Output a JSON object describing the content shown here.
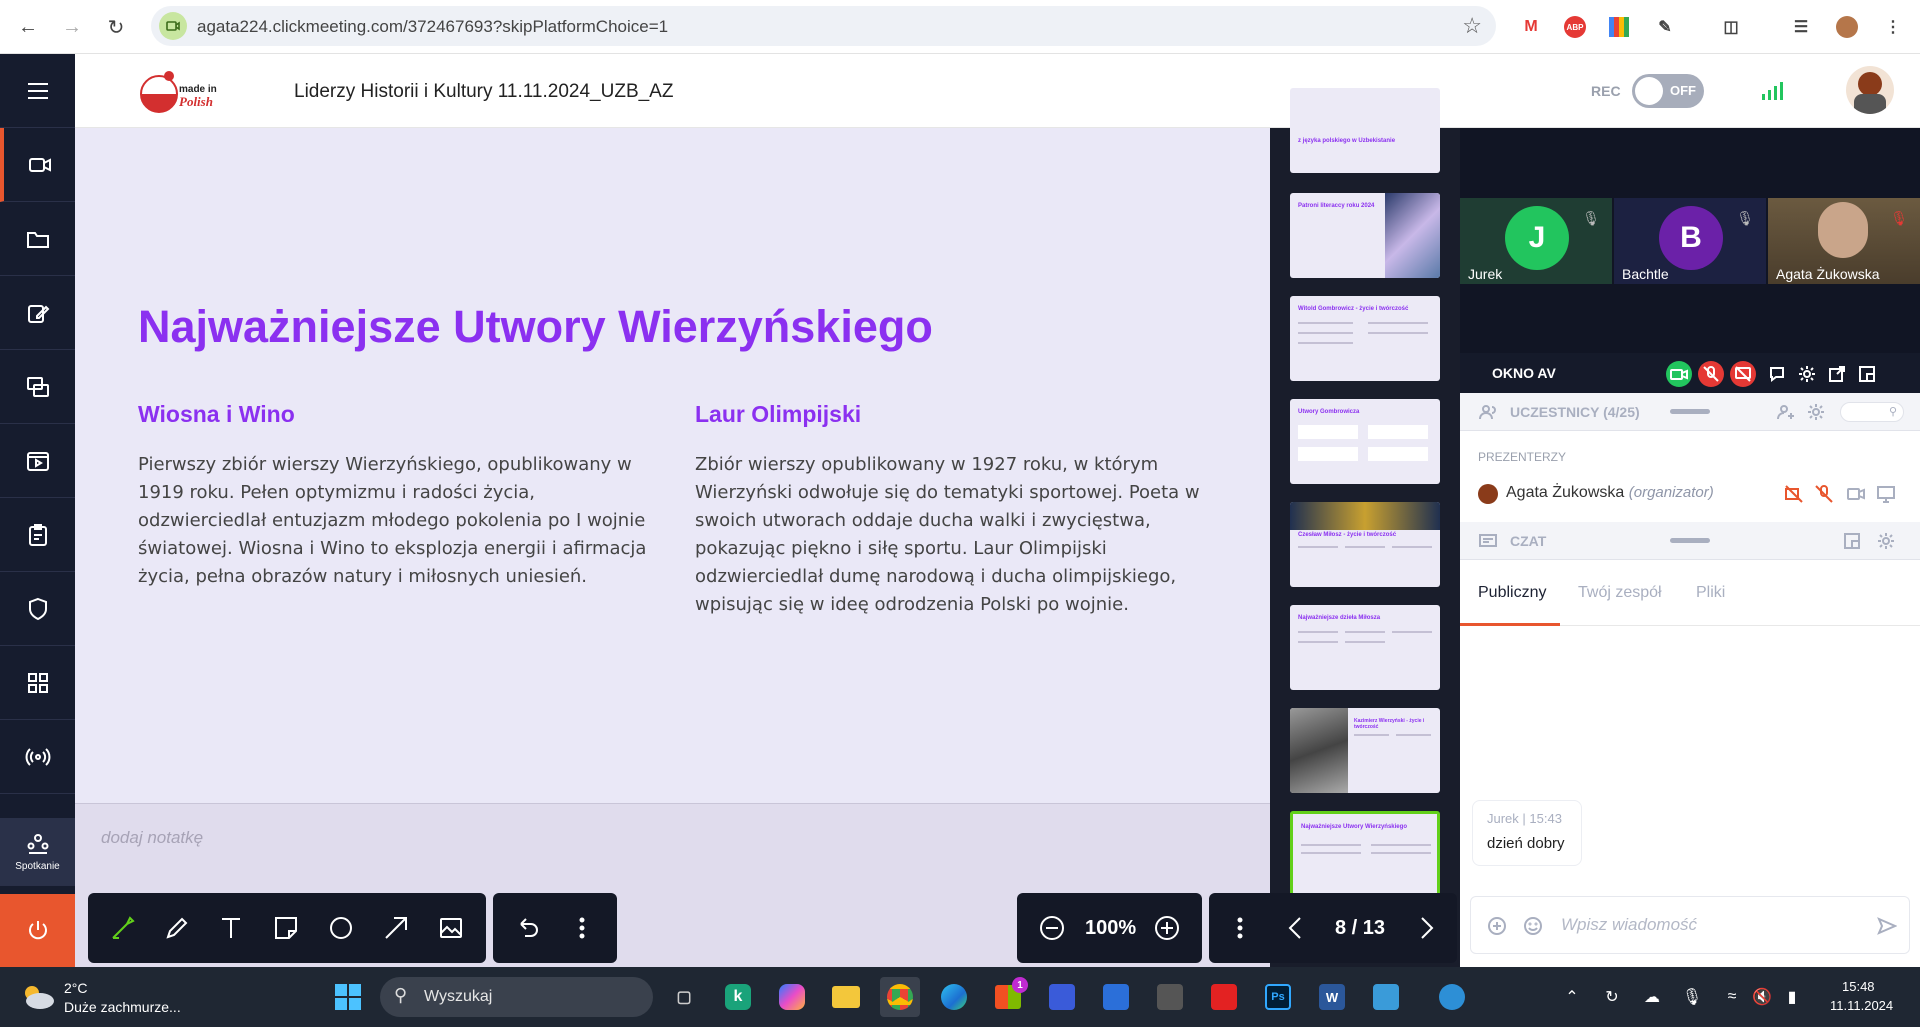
{
  "browser": {
    "url": "agata224.clickmeeting.com/372467693?skipPlatformChoice=1",
    "extensions": [
      "gmail-icon",
      "adblock-icon",
      "google-icon",
      "puzzle-icon"
    ]
  },
  "header": {
    "logo_text": "made in Polish",
    "meeting_title": "Liderzy Historii i Kultury 11.11.2024_UZB_AZ",
    "rec_label": "REC",
    "rec_state": "OFF"
  },
  "sidebar": {
    "meeting_label": "Spotkanie"
  },
  "slide": {
    "title": "Najważniejsze Utwory Wierzyńskiego",
    "col1_heading": "Wiosna i Wino",
    "col1_text": "Pierwszy zbiór wierszy Wierzyńskiego, opublikowany w 1919 roku. Pełen optymizmu i radości życia, odzwierciedlał entuzjazm młodego pokolenia po I wojnie światowej. Wiosna i Wino to eksplozja energii i afirmacja życia, pełna obrazów natury i miłosnych uniesień.",
    "col2_heading": "Laur Olimpijski",
    "col2_text": "Zbiór wierszy opublikowany w 1927 roku, w którym Wierzyński odwołuje się do tematyki sportowej. Poeta w swoich utworach oddaje ducha walki i zwycięstwa, pokazując piękno i siłę sportu. Laur Olimpijski odzwierciedlał dumę narodową i ducha olimpijskiego, wpisując się w ideę odrodzenia Polski po wojnie."
  },
  "notes": {
    "placeholder": "dodaj notatkę"
  },
  "thumbnails": {
    "titles": [
      "z języka polskiego w Uzbekistanie",
      "Patroni literaccy roku 2024",
      "Witold Gombrowicz - życie i twórczość",
      "Utwory Gombrowicza",
      "Czesław Miłosz - życie i twórczość",
      "Najważniejsze dzieła Miłosza",
      "Kazimierz Wierzyński - życie i twórczość",
      "Najważniejsze Utwory Wierzyńskiego"
    ],
    "active_index": 7
  },
  "toolbar": {
    "zoom": "100%",
    "page": "8 / 13"
  },
  "video": {
    "tiles": [
      {
        "initial": "J",
        "name": "Jurek",
        "color": "#22c55e"
      },
      {
        "initial": "B",
        "name": "Bachtle",
        "color": "#6b21a8"
      },
      {
        "initial": "",
        "name": "Agata Żukowska",
        "color": "#7a6a55"
      }
    ]
  },
  "av_bar": {
    "label": "OKNO AV"
  },
  "participants": {
    "label": "UCZESTNICY (4/25)",
    "presenters_label": "PREZENTERZY",
    "presenter_name": "Agata Żukowska",
    "presenter_role": "(organizator)"
  },
  "chat": {
    "label": "CZAT",
    "tabs": [
      "Publiczny",
      "Twój zespół",
      "Pliki"
    ],
    "message_author": "Jurek",
    "message_time": "15:43",
    "message_text": "dzień dobry",
    "input_placeholder": "Wpisz wiadomość"
  },
  "taskbar": {
    "temperature": "2°C",
    "weather": "Duże zachmurze...",
    "search": "Wyszukaj",
    "time": "15:48",
    "date": "11.11.2024",
    "store_badge": "1"
  },
  "colors": {
    "accent": "#8b30f0",
    "leave": "#e8562e",
    "active_thumb": "#62d01a"
  }
}
